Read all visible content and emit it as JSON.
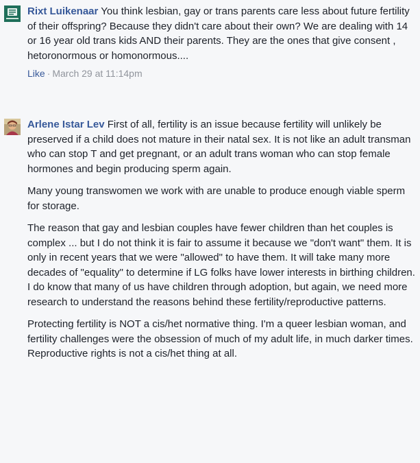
{
  "comments": [
    {
      "author": "Rixt Luikenaar",
      "avatar": "book-logo-avatar",
      "paragraphs": [
        "You think lesbian, gay or trans parents care less about future fertility of their offspring? Because they didn't care about their own? We are dealing with 14 or 16 year old trans kids AND their parents. They are the ones that give consent , hetoronormous or homonormous...."
      ],
      "like_label": "Like",
      "separator": "·",
      "timestamp": "March 29 at 11:14pm"
    },
    {
      "author": "Arlene Istar Lev",
      "avatar": "person-photo-avatar",
      "paragraphs": [
        "First of all, fertility is an issue because fertility will unlikely be preserved if a child does not mature in their natal sex. It is not like an adult transman who can stop T and get pregnant, or an adult trans woman who can stop female hormones and begin producing sperm again.",
        "Many young transwomen we work with are unable to produce enough viable sperm for storage.",
        "The reason that gay and lesbian couples have fewer children than het couples is complex ... but I do not think it is fair to assume it because we \"don't want\" them. It is only in recent years that we were \"allowed\" to have them. It will take many more decades of \"equality\" to determine if LG folks have lower interests in birthing children. I do know that many of us have children through adoption, but again, we need more research to understand the reasons behind these fertility/reproductive patterns.",
        "Protecting fertility is NOT a cis/het normative thing. I'm a queer lesbian woman, and fertility challenges were the obsession of much of my adult life, in much darker times. Reproductive rights is not a cis/het thing at all."
      ]
    }
  ]
}
